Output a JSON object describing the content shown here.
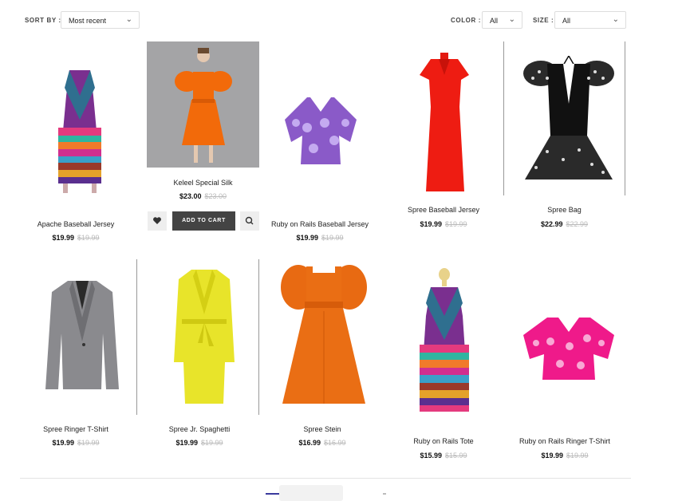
{
  "filters": {
    "sort_label": "SORT BY :",
    "sort_value": "Most recent",
    "color_label": "COLOR :",
    "color_value": "All",
    "size_label": "SIZE :",
    "size_value": "All"
  },
  "currency_note": "",
  "hover_actions": {
    "add_to_cart": "ADD TO CART"
  },
  "products": [
    {
      "name": "Apache Baseball Jersey",
      "price": "$19.99",
      "old_price": "$19.99",
      "image": "striped-dress-icon"
    },
    {
      "name": "Keleel Special Silk",
      "price": "$23.00",
      "old_price": "$23.00",
      "image": "orange-puff-dress-model-icon"
    },
    {
      "name": "Ruby on Rails Baseball Jersey",
      "price": "$19.99",
      "old_price": "$19.99",
      "image": "purple-top-icon"
    },
    {
      "name": "Spree Baseball Jersey",
      "price": "$19.99",
      "old_price": "$19.99",
      "image": "red-dress-icon"
    },
    {
      "name": "Spree Bag",
      "price": "$22.99",
      "old_price": "$22.99",
      "image": "black-peplum-top-icon"
    },
    {
      "name": "Spree Ringer T-Shirt",
      "price": "$19.99",
      "old_price": "$19.99",
      "image": "grey-blazer-icon"
    },
    {
      "name": "Spree Jr. Spaghetti",
      "price": "$19.99",
      "old_price": "$19.99",
      "image": "yellow-coat-icon"
    },
    {
      "name": "Spree Stein",
      "price": "$16.99",
      "old_price": "$16.99",
      "image": "orange-puff-dress-icon"
    },
    {
      "name": "Ruby on Rails Tote",
      "price": "$15.99",
      "old_price": "$15.99",
      "image": "striped-dress-mannequin-icon"
    },
    {
      "name": "Ruby on Rails Ringer T-Shirt",
      "price": "$19.99",
      "old_price": "$19.99",
      "image": "pink-top-icon"
    }
  ],
  "colors": {
    "accent": "#444444",
    "pager_active": "#3a3a9e",
    "old_price": "#bbbbbb"
  }
}
